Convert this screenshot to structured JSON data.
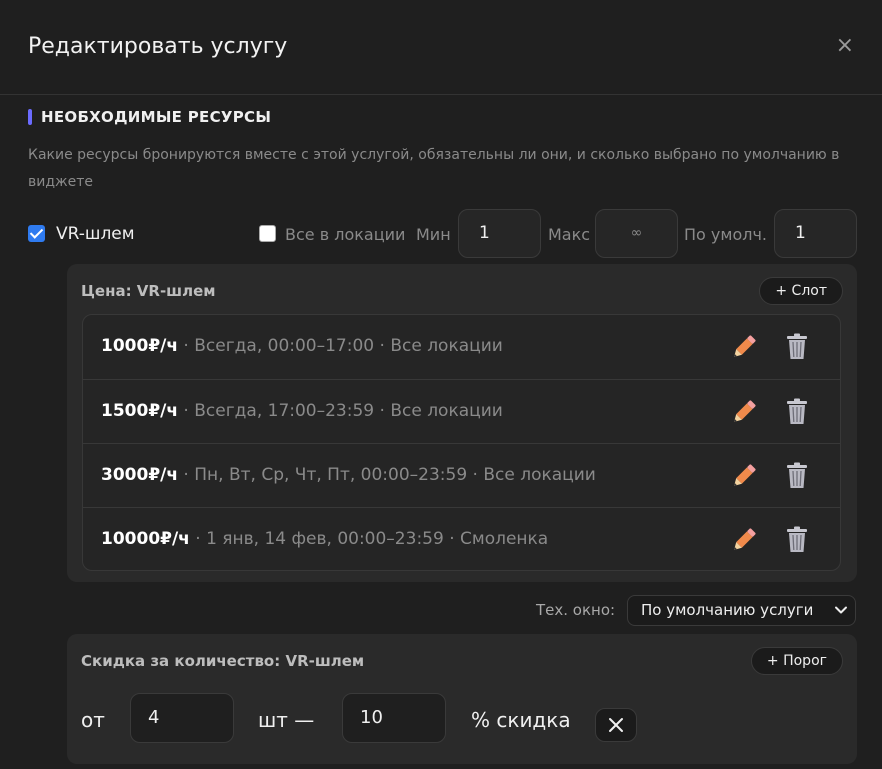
{
  "dialog": {
    "title": "Редактировать услугу",
    "close_glyph": "×"
  },
  "section": {
    "title": "НЕОБХОДИМЫЕ РЕСУРСЫ",
    "description": "Какие ресурсы бронируются вместе с этой услугой, обязательны ли они, и сколько выбрано по умолчанию в виджете"
  },
  "resource": {
    "name": "VR-шлем",
    "checked": true,
    "all_locations_label": "Все в локации",
    "all_locations_checked": false,
    "min_label": "Мин",
    "min_value": "1",
    "max_label": "Макс",
    "max_placeholder": "∞",
    "default_label": "По умолч.",
    "default_value": "1"
  },
  "price": {
    "title": "Цена: VR-шлем",
    "add_slot_label": "+ Слот",
    "rows": [
      {
        "price": "1000₽/ч",
        "details": " · Всегда, 00:00–17:00 · Все локации"
      },
      {
        "price": "1500₽/ч",
        "details": " · Всегда, 17:00–23:59 · Все локации"
      },
      {
        "price": "3000₽/ч",
        "details": " · Пн, Вт, Ср, Чт, Пт, 00:00–23:59 · Все локации"
      },
      {
        "price": "10000₽/ч",
        "details": " · 1 янв, 14 фев, 00:00–23:59 · Смоленка"
      }
    ]
  },
  "tech_window": {
    "label": "Тех. окно:",
    "selected": "По умолчанию услуги"
  },
  "discount": {
    "title": "Скидка за количество: VR-шлем",
    "add_threshold_label": "+ Порог",
    "from_label": "от",
    "from_value": "4",
    "unit_label": "шт —",
    "percent_value": "10",
    "percent_label": "% скидка"
  },
  "icons": [
    "close-icon",
    "checkbox-icon",
    "pencil-icon",
    "trash-icon",
    "chevron-down-icon",
    "x-icon"
  ],
  "colors": {
    "accent": "#6b6bff",
    "checkbox": "#2f7bf0",
    "pencil": "#f08a4b",
    "background": "#1f1f1f",
    "panel": "#2a2a2a"
  }
}
